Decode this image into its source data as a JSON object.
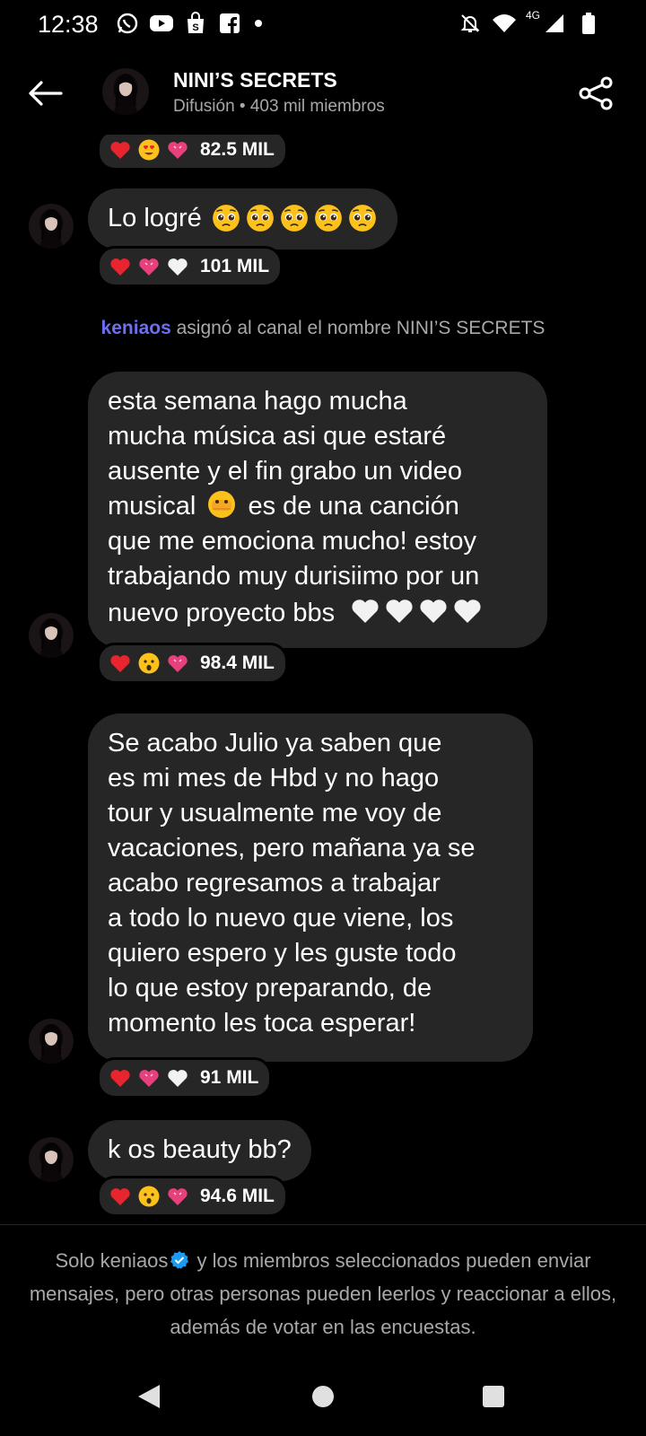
{
  "status_bar": {
    "time": "12:38",
    "network_label": "4G",
    "left_icons": [
      "whatsapp-icon",
      "youtube-icon",
      "shopping-bag-icon",
      "facebook-icon",
      "notification-dot"
    ],
    "right_icons": [
      "bell-off-icon",
      "wifi-icon",
      "signal-icon",
      "battery-icon"
    ]
  },
  "header": {
    "title": "NINI’S SECRETS",
    "subtitle": "Difusión • 403 mil miembros"
  },
  "messages": [
    {
      "text": "",
      "reactions": {
        "emojis": [
          "heart-red",
          "heart-eyes",
          "heart-pink"
        ],
        "count": "82.5 MIL"
      }
    },
    {
      "text": "Lo logré",
      "trailing_emoji": "pleading-face x5",
      "reactions": {
        "emojis": [
          "heart-red",
          "heart-pink",
          "heart-white"
        ],
        "count": "101 MIL"
      }
    },
    {
      "text": "esta semana hago mucha\nmucha música asi que estaré\nausente y el fin grabo un video\nmusical",
      "text_after_emoji": "es de una canción\nque me emociona mucho! estoy\ntrabajando muy durisiimo por un\nnuevo proyecto bbs",
      "reactions": {
        "emojis": [
          "heart-red",
          "surprised-face",
          "heart-pink"
        ],
        "count": "98.4 MIL"
      }
    },
    {
      "text": "Se acabo Julio ya saben que\nes mi mes de Hbd y no hago\ntour y usualmente me voy de\nvacaciones, pero mañana ya se\nacabo regresamos a trabajar\na todo lo nuevo que viene, los\nquiero espero y les guste todo\nlo que estoy preparando, de\nmomento les toca esperar!",
      "reactions": {
        "emojis": [
          "heart-red",
          "heart-pink",
          "heart-white"
        ],
        "count": "91 MIL"
      }
    },
    {
      "text": "k os beauty bb?",
      "reactions": {
        "emojis": [
          "heart-red",
          "surprised-face",
          "heart-pink"
        ],
        "count": "94.6 MIL"
      }
    }
  ],
  "system_message": {
    "user": "keniaos",
    "text": " asignó al canal el nombre NINI’S SECRETS"
  },
  "footer": {
    "prefix": "Solo keniaos",
    "suffix": " y los miembros seleccionados pueden enviar mensajes, pero otras personas pueden leerlos y reaccionar a ellos, además de votar en las encuestas."
  },
  "colors": {
    "background": "#000000",
    "bubble": "#262626",
    "secondary_text": "#a8a8a8",
    "system_user": "#6d6ff2",
    "verified": "#1d9bf0"
  }
}
